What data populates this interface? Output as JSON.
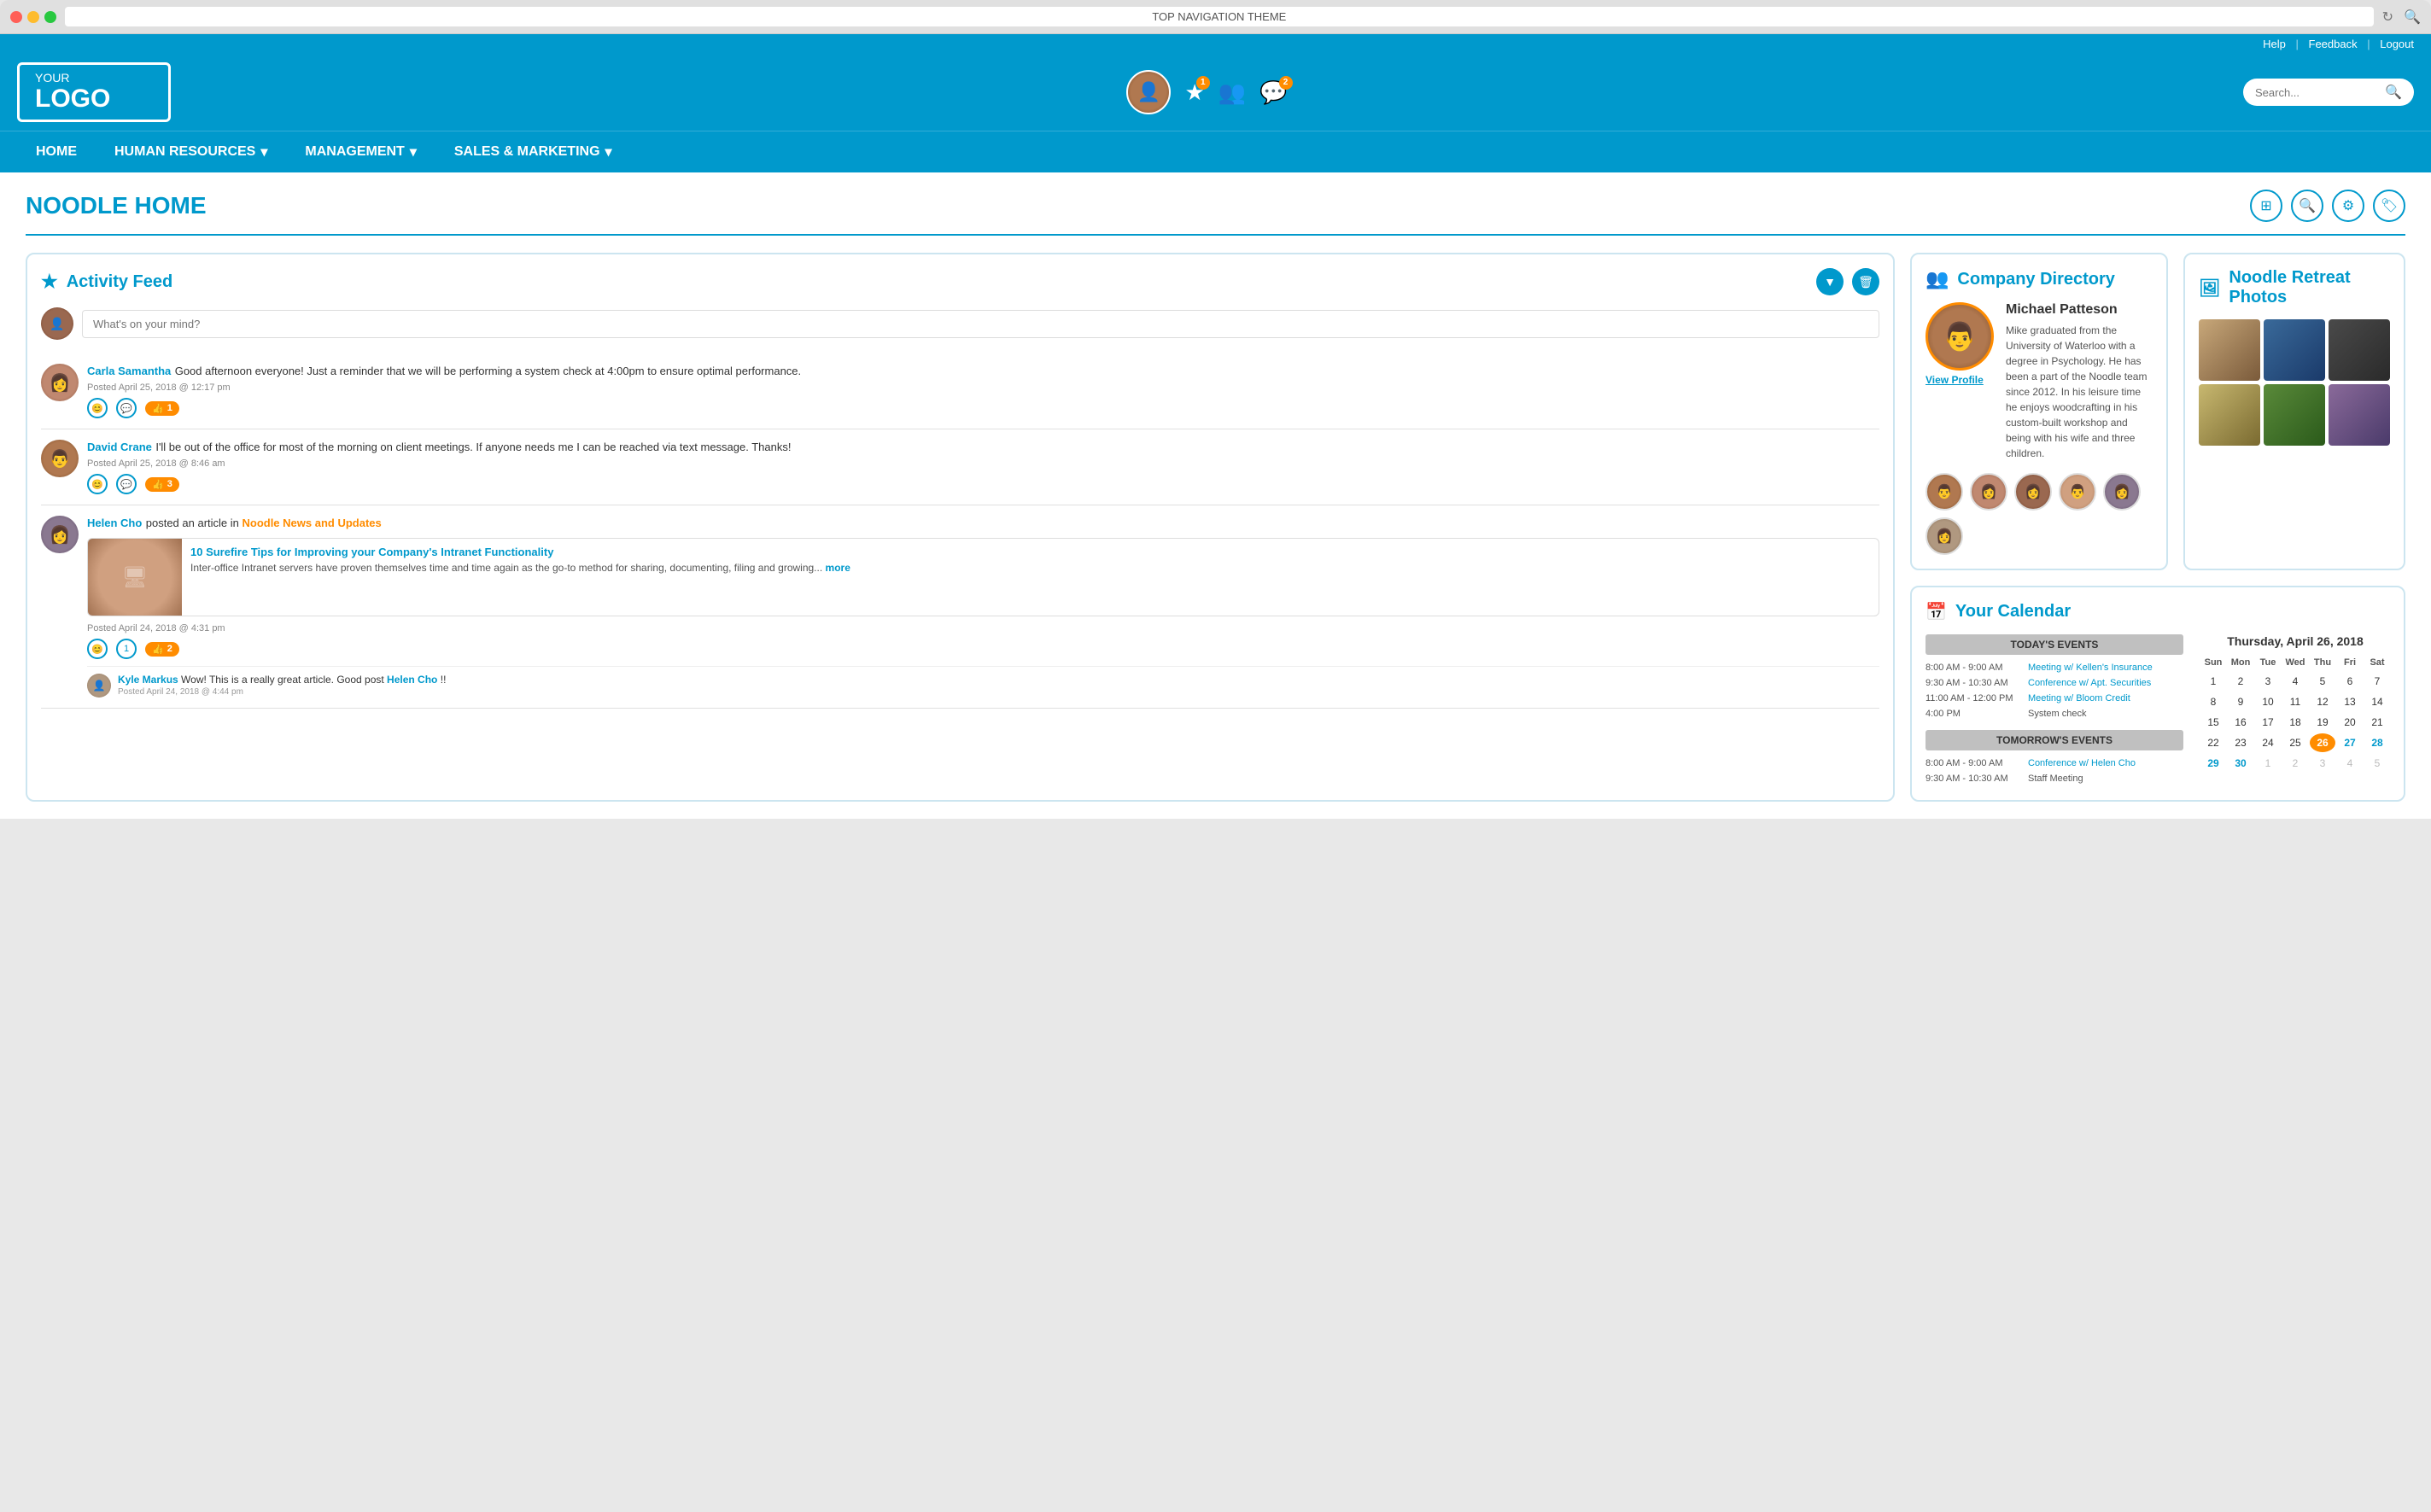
{
  "browser": {
    "title": "TOP NAVIGATION THEME",
    "search_placeholder": "Search..."
  },
  "utility_bar": {
    "help": "Help",
    "feedback": "Feedback",
    "logout": "Logout"
  },
  "header": {
    "logo_your": "YOUR",
    "logo_text": "LOGO",
    "search_placeholder": "Search..."
  },
  "nav": {
    "items": [
      {
        "label": "HOME",
        "has_dropdown": false
      },
      {
        "label": "HUMAN RESOURCES",
        "has_dropdown": true
      },
      {
        "label": "MANAGEMENT",
        "has_dropdown": true
      },
      {
        "label": "SALES & MARKETING",
        "has_dropdown": true
      }
    ]
  },
  "page": {
    "title": "NOODLE HOME"
  },
  "activity_feed": {
    "title": "Activity Feed",
    "post_placeholder": "What's on your mind?",
    "posts": [
      {
        "author": "Carla Samantha",
        "text": "Good afternoon everyone! Just a reminder that we will be performing a system check at 4:00pm to ensure optimal performance.",
        "date": "Posted April 25, 2018 @ 12:17 pm",
        "likes": 1
      },
      {
        "author": "David Crane",
        "text": "I'll be out of the office for most of the morning on client meetings. If anyone needs me I can be reached via text message. Thanks!",
        "date": "Posted April 25, 2018 @ 8:46 am",
        "likes": 3
      },
      {
        "author": "Helen Cho",
        "post_prefix": "posted an article in",
        "category": "Noodle News and Updates",
        "article_title": "10 Surefire Tips for Improving your Company's Intranet Functionality",
        "article_text": "Inter-office Intranet servers have proven themselves time and time again as the go-to method for sharing, documenting, filing and growing...",
        "article_more": "more",
        "date": "Posted April 24, 2018 @ 4:31 pm",
        "likes": 2,
        "comments": 1,
        "comment_author": "Kyle Markus",
        "comment_text": "Wow! This is a really great article. Good post ",
        "comment_link": "Helen Cho",
        "comment_suffix": "!!",
        "comment_date": "Posted April 24, 2018 @ 4:44 pm"
      }
    ]
  },
  "company_directory": {
    "title": "Company Directory",
    "person": {
      "name": "Michael Patteson",
      "bio": "Mike graduated from the University of Waterloo with a degree in Psychology. He has been a part of the Noodle team since 2012. In his leisure time he enjoys woodcrafting in his custom-built workshop and being with his wife and three children.",
      "view_profile": "View Profile"
    }
  },
  "photos": {
    "title": "Noodle Retreat Photos"
  },
  "calendar": {
    "title": "Your Calendar",
    "cal_title": "Thursday, April 26, 2018",
    "days_header": [
      "Sun",
      "Mon",
      "Tue",
      "Wed",
      "Thu",
      "Fri",
      "Sat"
    ],
    "today_events_header": "TODAY'S EVENTS",
    "tomorrow_events_header": "TOMORROW'S EVENTS",
    "today_events": [
      {
        "time": "8:00 AM - 9:00 AM",
        "name": "Meeting w/ Kellen's Insurance",
        "is_link": true
      },
      {
        "time": "9:30 AM - 10:30 AM",
        "name": "Conference w/ Apt. Securities",
        "is_link": true
      },
      {
        "time": "11:00 AM - 12:00 PM",
        "name": "Meeting w/ Bloom Credit",
        "is_link": true
      },
      {
        "time": "4:00 PM",
        "name": "System check",
        "is_link": false
      }
    ],
    "tomorrow_events": [
      {
        "time": "8:00 AM - 9:00 AM",
        "name": "Conference w/ Helen Cho",
        "is_link": true
      },
      {
        "time": "9:30 AM - 10:30 AM",
        "name": "Staff Meeting",
        "is_link": false
      }
    ],
    "cal_days": [
      "",
      "",
      "3",
      "4",
      "5",
      "6",
      "7",
      "8",
      "9",
      "10",
      "11",
      "12",
      "13",
      "14",
      "15",
      "16",
      "17",
      "18",
      "19",
      "20",
      "21",
      "22",
      "23",
      "24",
      "25",
      "26",
      "27",
      "28",
      "29",
      "30",
      "1",
      "2",
      "3",
      "4",
      "5"
    ]
  }
}
